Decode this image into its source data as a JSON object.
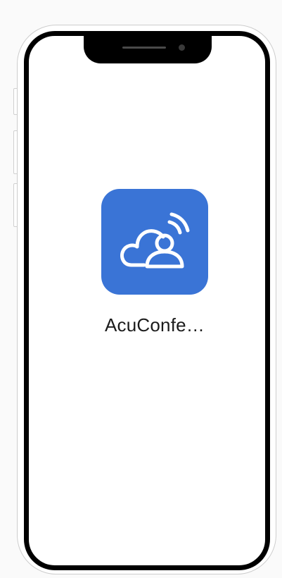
{
  "home_screen": {
    "apps": [
      {
        "label": "AcuConfe…",
        "icon": "cloud-user-signal-icon",
        "icon_color": "#3a74d6"
      }
    ]
  }
}
